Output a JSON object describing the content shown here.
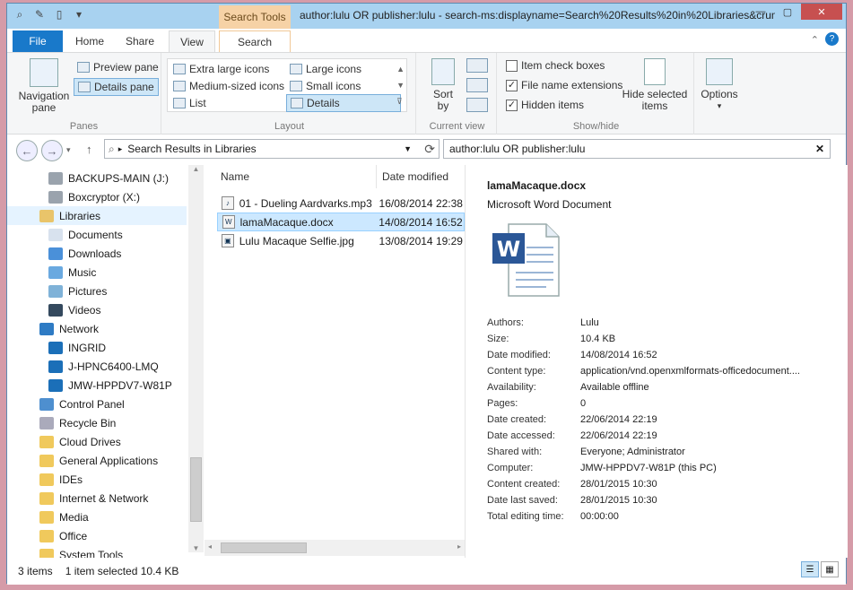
{
  "window": {
    "title": "author:lulu OR publisher:lulu - search-ms:displayname=Search%20Results%20in%20Libraries&crumb=l",
    "context_tab": "Search Tools"
  },
  "tabs": {
    "file": "File",
    "home": "Home",
    "share": "Share",
    "view": "View",
    "search": "Search"
  },
  "ribbon": {
    "panes": {
      "label": "Panes",
      "navigation_pane": "Navigation\npane",
      "preview_pane": "Preview pane",
      "details_pane": "Details pane"
    },
    "layout": {
      "label": "Layout",
      "items": [
        "Extra large icons",
        "Large icons",
        "Medium-sized icons",
        "Small icons",
        "List",
        "Details"
      ],
      "selected": "Details"
    },
    "current_view": {
      "label": "Current view",
      "sort_by": "Sort\nby"
    },
    "show_hide": {
      "label": "Show/hide",
      "item_check_boxes": "Item check boxes",
      "file_name_extensions": "File name extensions",
      "hidden_items": "Hidden items",
      "hide_selected": "Hide selected\nitems",
      "options": "Options"
    }
  },
  "address": {
    "path": "Search Results in Libraries",
    "search_value": "author:lulu OR publisher:lulu"
  },
  "nav": {
    "items": [
      {
        "label": "BACKUPS-MAIN (J:)",
        "indent": 2,
        "icon": "drive-icon"
      },
      {
        "label": "Boxcryptor (X:)",
        "indent": 2,
        "icon": "drive-icon"
      },
      {
        "label": "Libraries",
        "indent": 1,
        "icon": "libraries-icon",
        "selected": true
      },
      {
        "label": "Documents",
        "indent": 2,
        "icon": "documents-icon"
      },
      {
        "label": "Downloads",
        "indent": 2,
        "icon": "downloads-icon"
      },
      {
        "label": "Music",
        "indent": 2,
        "icon": "music-icon"
      },
      {
        "label": "Pictures",
        "indent": 2,
        "icon": "pictures-icon"
      },
      {
        "label": "Videos",
        "indent": 2,
        "icon": "videos-icon"
      },
      {
        "label": "Network",
        "indent": 1,
        "icon": "network-icon"
      },
      {
        "label": "INGRID",
        "indent": 2,
        "icon": "computer-icon"
      },
      {
        "label": "J-HPNC6400-LMQ",
        "indent": 2,
        "icon": "computer-icon"
      },
      {
        "label": "JMW-HPPDV7-W81P",
        "indent": 2,
        "icon": "computer-icon"
      },
      {
        "label": "Control Panel",
        "indent": 1,
        "icon": "control-panel-icon"
      },
      {
        "label": "Recycle Bin",
        "indent": 1,
        "icon": "recycle-bin-icon"
      },
      {
        "label": "Cloud Drives",
        "indent": 1,
        "icon": "folder-icon"
      },
      {
        "label": "General Applications",
        "indent": 1,
        "icon": "folder-icon"
      },
      {
        "label": "IDEs",
        "indent": 1,
        "icon": "folder-icon"
      },
      {
        "label": "Internet & Network",
        "indent": 1,
        "icon": "folder-icon"
      },
      {
        "label": "Media",
        "indent": 1,
        "icon": "folder-icon"
      },
      {
        "label": "Office",
        "indent": 1,
        "icon": "folder-icon"
      },
      {
        "label": "System Tools",
        "indent": 1,
        "icon": "folder-icon"
      }
    ]
  },
  "files": {
    "columns": [
      "Name",
      "Date modified"
    ],
    "rows": [
      {
        "name": "01 - Dueling Aardvarks.mp3",
        "date": "16/08/2014 22:38",
        "icon": "audio-file-icon"
      },
      {
        "name": "lamaMacaque.docx",
        "date": "14/08/2014 16:52",
        "icon": "word-file-icon",
        "selected": true
      },
      {
        "name": "Lulu Macaque Selfie.jpg",
        "date": "13/08/2014 19:29",
        "icon": "image-file-icon"
      }
    ]
  },
  "details": {
    "name": "lamaMacaque.docx",
    "type": "Microsoft Word Document",
    "properties": [
      {
        "label": "Authors:",
        "value": "Lulu"
      },
      {
        "label": "Size:",
        "value": "10.4 KB"
      },
      {
        "label": "Date modified:",
        "value": "14/08/2014 16:52"
      },
      {
        "label": "Content type:",
        "value": "application/vnd.openxmlformats-officedocument...."
      },
      {
        "label": "Availability:",
        "value": "Available offline"
      },
      {
        "label": "Pages:",
        "value": "0"
      },
      {
        "label": "Date created:",
        "value": "22/06/2014 22:19"
      },
      {
        "label": "Date accessed:",
        "value": "22/06/2014 22:19"
      },
      {
        "label": "Shared with:",
        "value": "Everyone; Administrator"
      },
      {
        "label": "Computer:",
        "value": "JMW-HPPDV7-W81P (this PC)"
      },
      {
        "label": "Content created:",
        "value": "28/01/2015 10:30"
      },
      {
        "label": "Date last saved:",
        "value": "28/01/2015 10:30"
      },
      {
        "label": "Total editing time:",
        "value": "00:00:00"
      }
    ]
  },
  "status": {
    "count": "3 items",
    "selection": "1 item selected  10.4 KB"
  }
}
